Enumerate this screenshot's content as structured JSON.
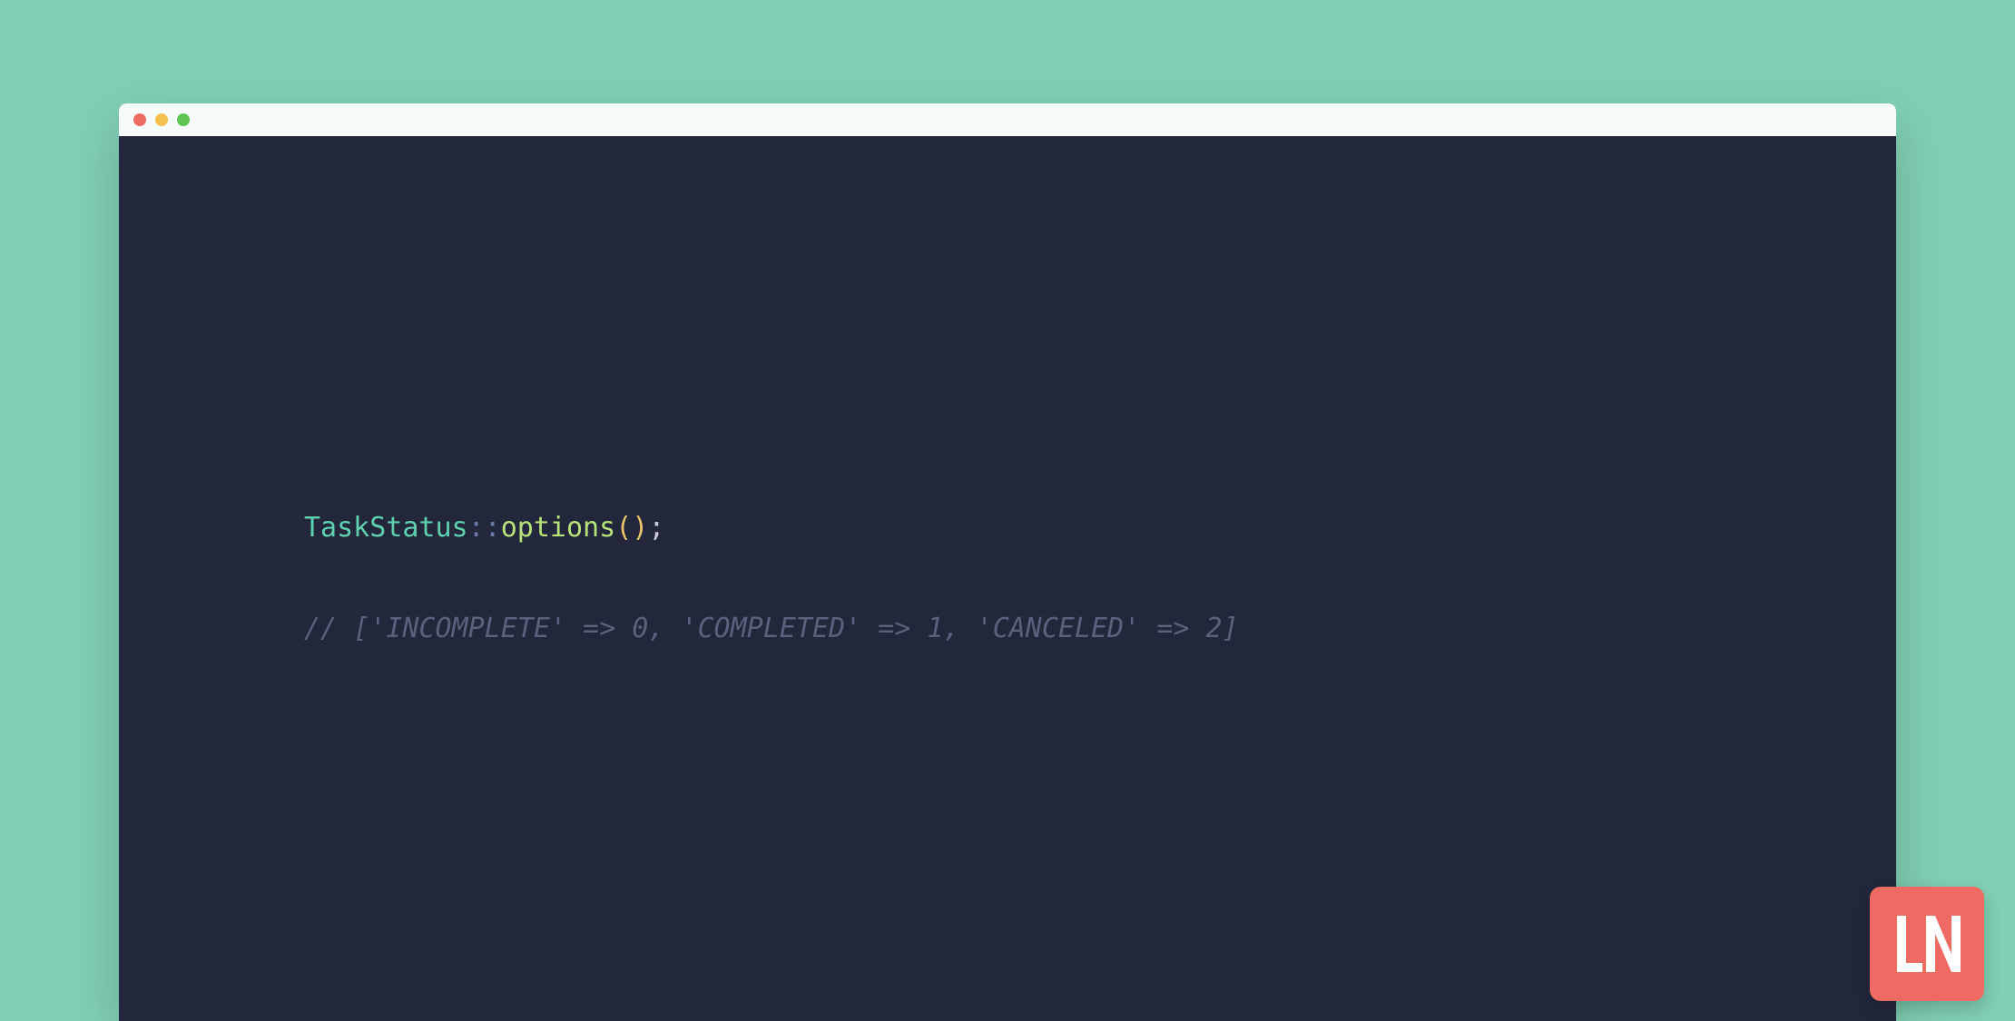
{
  "colors": {
    "page_bg": "#80d0b4",
    "editor_bg": "#22273b",
    "titlebar_bg": "#f4fbf8",
    "traffic_red": "#ec6a5e",
    "traffic_yellow": "#f3bf4f",
    "traffic_green": "#60c454",
    "token_class": "#5fd1b0",
    "token_dcolon": "#6a7aa8",
    "token_func": "#b6e37a",
    "token_paren": "#e9c46a",
    "token_punct": "#c6c9d8",
    "token_comment": "#5a607d",
    "logo_bg": "#ef6a63",
    "logo_fg": "#ffffff"
  },
  "code": {
    "line1": {
      "class": "TaskStatus",
      "dcolon": "::",
      "func": "options",
      "open": "(",
      "close": ")",
      "semi": ";"
    },
    "line2": {
      "comment": "// ['INCOMPLETE' => 0, 'COMPLETED' => 1, 'CANCELED' => 2]"
    }
  },
  "logo": {
    "text": "LN"
  }
}
